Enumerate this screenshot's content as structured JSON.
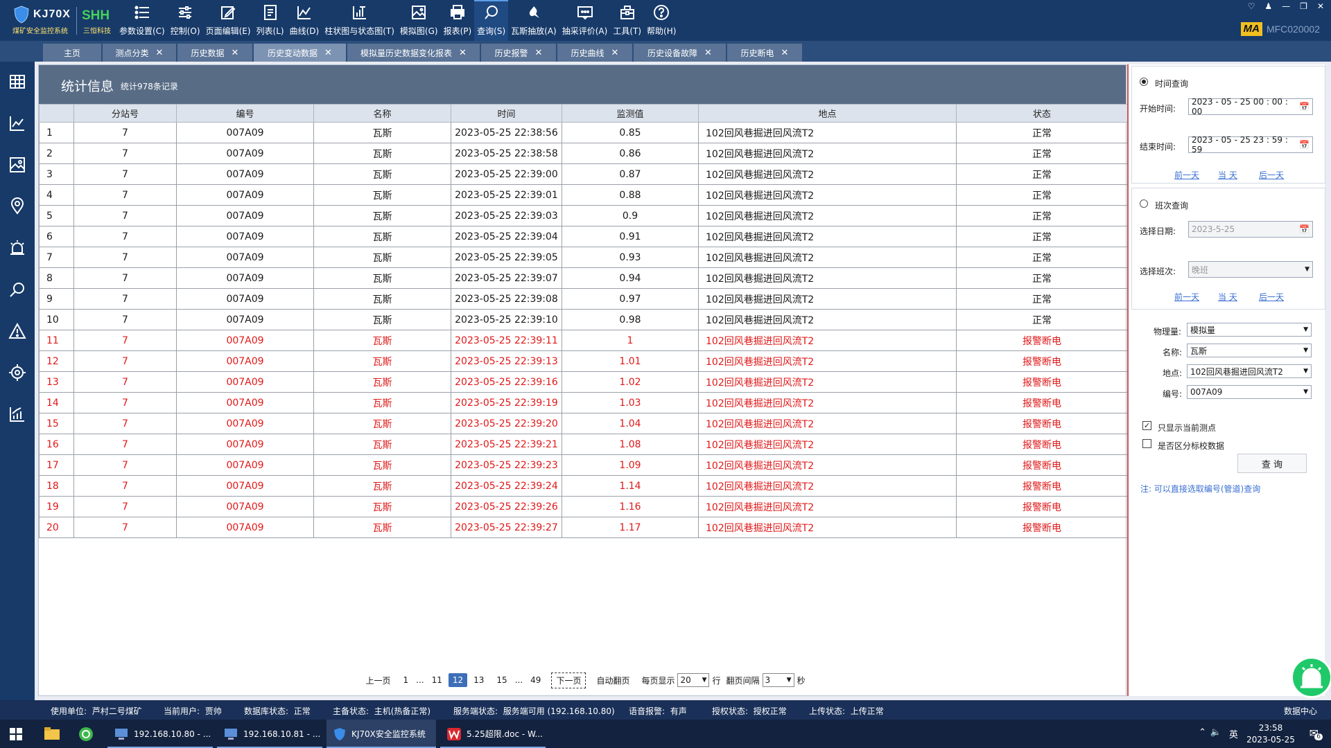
{
  "app": {
    "logo_text": "KJ70X",
    "logo_subtitle": "煤矿安全监控系统",
    "brand_text": "SHH",
    "brand_subtitle": "三恒科技",
    "device_badge": "MA",
    "device_id": "MFC020002"
  },
  "menu": [
    {
      "label": "参数设置(C)",
      "icon": "list-icon"
    },
    {
      "label": "控制(O)",
      "icon": "sliders-icon"
    },
    {
      "label": "页面编辑(E)",
      "icon": "edit-icon"
    },
    {
      "label": "列表(L)",
      "icon": "document-icon"
    },
    {
      "label": "曲线(D)",
      "icon": "line-chart-icon"
    },
    {
      "label": "柱状图与状态图(T)",
      "icon": "bar-chart-icon"
    },
    {
      "label": "模拟图(G)",
      "icon": "image-icon"
    },
    {
      "label": "报表(P)",
      "icon": "printer-icon"
    },
    {
      "label": "查询(S)",
      "icon": "search-icon"
    },
    {
      "label": "瓦斯抽放(A)",
      "icon": "gas-drainage-icon"
    },
    {
      "label": "抽采评价(A)",
      "icon": "evaluation-icon"
    },
    {
      "label": "工具(T)",
      "icon": "toolbox-icon"
    },
    {
      "label": "帮助(H)",
      "icon": "help-icon"
    }
  ],
  "tabs": [
    {
      "label": "主页",
      "closable": false
    },
    {
      "label": "测点分类",
      "closable": true
    },
    {
      "label": "历史数据",
      "closable": true
    },
    {
      "label": "历史变动数据",
      "closable": true,
      "active": true
    },
    {
      "label": "模拟量历史数据变化报表",
      "closable": true
    },
    {
      "label": "历史报警",
      "closable": true
    },
    {
      "label": "历史曲线",
      "closable": true
    },
    {
      "label": "历史设备故障",
      "closable": true
    },
    {
      "label": "历史断电",
      "closable": true
    }
  ],
  "main": {
    "title": "统计信息",
    "count_text": "统计978条记录",
    "columns": [
      "",
      "分站号",
      "编号",
      "名称",
      "时间",
      "监测值",
      "地点",
      "状态"
    ],
    "rows": [
      [
        "1",
        "7",
        "007A09",
        "瓦斯",
        "2023-05-25 22:38:56",
        "0.85",
        "102回风巷掘进回风流T2",
        "正常"
      ],
      [
        "2",
        "7",
        "007A09",
        "瓦斯",
        "2023-05-25 22:38:58",
        "0.86",
        "102回风巷掘进回风流T2",
        "正常"
      ],
      [
        "3",
        "7",
        "007A09",
        "瓦斯",
        "2023-05-25 22:39:00",
        "0.87",
        "102回风巷掘进回风流T2",
        "正常"
      ],
      [
        "4",
        "7",
        "007A09",
        "瓦斯",
        "2023-05-25 22:39:01",
        "0.88",
        "102回风巷掘进回风流T2",
        "正常"
      ],
      [
        "5",
        "7",
        "007A09",
        "瓦斯",
        "2023-05-25 22:39:03",
        "0.9",
        "102回风巷掘进回风流T2",
        "正常"
      ],
      [
        "6",
        "7",
        "007A09",
        "瓦斯",
        "2023-05-25 22:39:04",
        "0.91",
        "102回风巷掘进回风流T2",
        "正常"
      ],
      [
        "7",
        "7",
        "007A09",
        "瓦斯",
        "2023-05-25 22:39:05",
        "0.93",
        "102回风巷掘进回风流T2",
        "正常"
      ],
      [
        "8",
        "7",
        "007A09",
        "瓦斯",
        "2023-05-25 22:39:07",
        "0.94",
        "102回风巷掘进回风流T2",
        "正常"
      ],
      [
        "9",
        "7",
        "007A09",
        "瓦斯",
        "2023-05-25 22:39:08",
        "0.97",
        "102回风巷掘进回风流T2",
        "正常"
      ],
      [
        "10",
        "7",
        "007A09",
        "瓦斯",
        "2023-05-25 22:39:10",
        "0.98",
        "102回风巷掘进回风流T2",
        "正常"
      ],
      [
        "11",
        "7",
        "007A09",
        "瓦斯",
        "2023-05-25 22:39:11",
        "1",
        "102回风巷掘进回风流T2",
        "报警断电"
      ],
      [
        "12",
        "7",
        "007A09",
        "瓦斯",
        "2023-05-25 22:39:13",
        "1.01",
        "102回风巷掘进回风流T2",
        "报警断电"
      ],
      [
        "13",
        "7",
        "007A09",
        "瓦斯",
        "2023-05-25 22:39:16",
        "1.02",
        "102回风巷掘进回风流T2",
        "报警断电"
      ],
      [
        "14",
        "7",
        "007A09",
        "瓦斯",
        "2023-05-25 22:39:19",
        "1.03",
        "102回风巷掘进回风流T2",
        "报警断电"
      ],
      [
        "15",
        "7",
        "007A09",
        "瓦斯",
        "2023-05-25 22:39:20",
        "1.04",
        "102回风巷掘进回风流T2",
        "报警断电"
      ],
      [
        "16",
        "7",
        "007A09",
        "瓦斯",
        "2023-05-25 22:39:21",
        "1.08",
        "102回风巷掘进回风流T2",
        "报警断电"
      ],
      [
        "17",
        "7",
        "007A09",
        "瓦斯",
        "2023-05-25 22:39:23",
        "1.09",
        "102回风巷掘进回风流T2",
        "报警断电"
      ],
      [
        "18",
        "7",
        "007A09",
        "瓦斯",
        "2023-05-25 22:39:24",
        "1.14",
        "102回风巷掘进回风流T2",
        "报警断电"
      ],
      [
        "19",
        "7",
        "007A09",
        "瓦斯",
        "2023-05-25 22:39:26",
        "1.16",
        "102回风巷掘进回风流T2",
        "报警断电"
      ],
      [
        "20",
        "7",
        "007A09",
        "瓦斯",
        "2023-05-25 22:39:27",
        "1.17",
        "102回风巷掘进回风流T2",
        "报警断电"
      ]
    ],
    "alarm_status": "报警断电",
    "alarm_color": "#e01818"
  },
  "pager": {
    "prev": "上一页",
    "pages": [
      "1",
      "...",
      "11",
      "12",
      "13",
      "15",
      "...",
      "49"
    ],
    "current": "12",
    "next": "下一页",
    "auto_label": "自动翻页",
    "per_page_label": "每页显示",
    "per_page_value": "20",
    "rows_unit": "行",
    "interval_label": "翻页间隔",
    "interval_value": "3",
    "seconds_unit": "秒"
  },
  "panel": {
    "time_query_label": "时间查询",
    "start_label": "开始时间:",
    "start_value": "2023 - 05 - 25  00 : 00 : 00",
    "end_label": "结束时间:",
    "end_value": "2023 - 05 - 25  23 : 59 : 59",
    "prev_day": "前一天",
    "today": "当 天",
    "next_day": "后一天",
    "shift_query_label": "班次查询",
    "date_label": "选择日期:",
    "date_value": "2023-5-25",
    "shift_label": "选择班次:",
    "shift_value": "晚班",
    "prev_day2": "前一天",
    "today2": "当 天",
    "next_day2": "后一天",
    "phys_label": "物理量:",
    "phys_value": "模拟量",
    "name_label": "名称:",
    "name_value": "瓦斯",
    "loc_label": "地点:",
    "loc_value": "102回风巷掘进回风流T2",
    "code_label": "编号:",
    "code_value": "007A09",
    "only_current_label": "只显示当前测点",
    "calib_label": "是否区分标校数据",
    "query_button": "查 询",
    "note": "注: 可以直接选取编号(管道)查询"
  },
  "status": {
    "unit_label": "使用单位:",
    "unit_value": "芦村二号煤矿",
    "user_label": "当前用户:",
    "user_value": "贾帅",
    "db_label": "数据库状态:",
    "db_value": "正常",
    "host_label": "主备状态:",
    "host_value": "主机(热备正常)",
    "svc_label": "服务端状态:",
    "svc_value": "服务端可用 (192.168.10.80)",
    "voice_label": "语音报警:",
    "voice_value": "有声",
    "auth_label": "授权状态:",
    "auth_value": "授权正常",
    "upload_label": "上传状态:",
    "upload_value": "上传正常",
    "datacenter": "数据中心"
  },
  "taskbar": {
    "apps": [
      "192.168.10.80 - ...",
      "192.168.10.81 - ...",
      "KJ70X安全监控系统",
      "5.25超限.doc - W..."
    ],
    "ime": "英",
    "time": "23:58",
    "date": "2023-05-25",
    "notif_count": "6"
  }
}
